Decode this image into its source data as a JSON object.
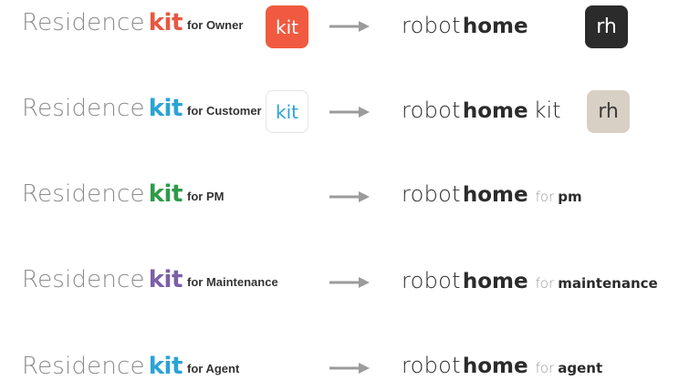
{
  "brand_old": {
    "word": "Residence",
    "mark": "kit"
  },
  "brand_new": {
    "word": "robot",
    "mark": "home",
    "kit_suffix": "kit",
    "for_word": "for"
  },
  "colors": {
    "owner": "#e8573f",
    "customer": "#2aa3d6",
    "pm": "#2f9a4a",
    "maintenance": "#7b5fa8",
    "agent": "#2aa3d6",
    "arrow": "#9b9b9b"
  },
  "rows": [
    {
      "audience": "for Owner",
      "old_icon": {
        "text": "kit",
        "icon": "kit-owner-app-icon"
      },
      "new_icon": {
        "text": "rh",
        "icon": "rh-dark-app-icon"
      }
    },
    {
      "audience": "for Customer",
      "old_icon": {
        "text": "kit",
        "icon": "kit-customer-app-icon"
      },
      "new_icon": {
        "text": "rh",
        "icon": "rh-beige-app-icon"
      },
      "new_kit": "kit"
    },
    {
      "audience": "for PM",
      "role": "pm"
    },
    {
      "audience": "for Maintenance",
      "role": "maintenance"
    },
    {
      "audience": "for Agent",
      "role": "agent"
    }
  ]
}
